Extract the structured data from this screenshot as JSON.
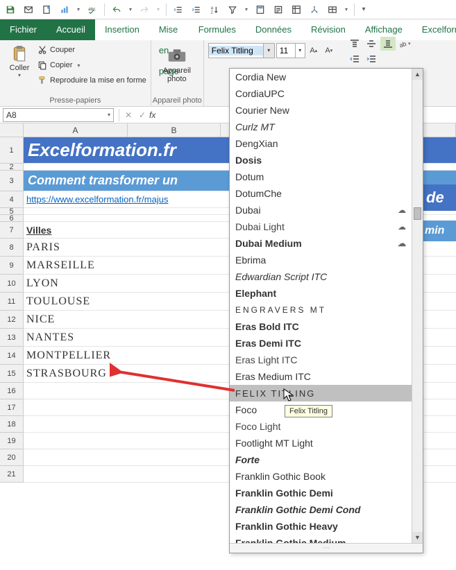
{
  "qat": {
    "icons": [
      "save",
      "mail",
      "newdoc",
      "chart",
      "spell",
      "undo",
      "redo",
      "outdent",
      "indent",
      "sort",
      "filter",
      "calc",
      "form",
      "pivot",
      "tree",
      "table"
    ]
  },
  "tabs": {
    "file": "Fichier",
    "items": [
      "Accueil",
      "Insertion",
      "Mise en page",
      "Formules",
      "Données",
      "Révision",
      "Affichage",
      "Excelform"
    ],
    "active_index": 0
  },
  "ribbon": {
    "paste_label": "Coller",
    "clip": {
      "cut": "Couper",
      "copy": "Copier",
      "repro": "Reproduire la mise en forme",
      "group": "Presse-papiers"
    },
    "camera": {
      "label": "Appareil\nphoto",
      "group": "Appareil photo"
    },
    "font": {
      "name": "Felix Titling",
      "size": "11"
    }
  },
  "formula_bar": {
    "name_box": "A8",
    "value": ""
  },
  "columns": [
    "A",
    "B"
  ],
  "rows": [
    {
      "num": "1",
      "type": "banner1",
      "text": "Excelformation.fr"
    },
    {
      "num": "2",
      "type": "short",
      "text": ""
    },
    {
      "num": "3",
      "type": "banner2",
      "text": "Comment transformer un"
    },
    {
      "num": "4",
      "type": "link",
      "text": "https://www.excelformation.fr/majus"
    },
    {
      "num": "5",
      "type": "short",
      "text": ""
    },
    {
      "num": "6",
      "type": "short",
      "text": ""
    },
    {
      "num": "7",
      "type": "head",
      "text": "Villes"
    },
    {
      "num": "8",
      "type": "city",
      "text": "PARIS"
    },
    {
      "num": "9",
      "type": "city",
      "text": "MARSEILLE"
    },
    {
      "num": "10",
      "type": "city",
      "text": "LYON"
    },
    {
      "num": "11",
      "type": "city",
      "text": "TOULOUSE"
    },
    {
      "num": "12",
      "type": "city",
      "text": "NICE"
    },
    {
      "num": "13",
      "type": "city",
      "text": "NANTES"
    },
    {
      "num": "14",
      "type": "city",
      "text": "MONTPELLIER"
    },
    {
      "num": "15",
      "type": "city",
      "text": "STRASBOURG"
    },
    {
      "num": "16",
      "type": "empty",
      "text": ""
    },
    {
      "num": "17",
      "type": "empty",
      "text": ""
    },
    {
      "num": "18",
      "type": "empty",
      "text": ""
    },
    {
      "num": "19",
      "type": "empty",
      "text": ""
    },
    {
      "num": "20",
      "type": "empty",
      "text": ""
    },
    {
      "num": "21",
      "type": "empty",
      "text": ""
    }
  ],
  "right_bars": {
    "bar1": "de",
    "bar2": "min"
  },
  "font_dropdown": {
    "selected": "FELIX TITLING",
    "tooltip": "Felix Titling",
    "items": [
      {
        "label": "Cordia New",
        "cls": "f-sans"
      },
      {
        "label": "CordiaUPC",
        "cls": "f-sans"
      },
      {
        "label": "Courier New",
        "cls": "f-mono"
      },
      {
        "label": "Curlz MT",
        "cls": "f-script"
      },
      {
        "label": "DengXian",
        "cls": "f-sans"
      },
      {
        "label": "Dosis",
        "cls": "f-sans f-bold"
      },
      {
        "label": "Dotum",
        "cls": "f-sans"
      },
      {
        "label": "DotumChe",
        "cls": "f-sans"
      },
      {
        "label": "Dubai",
        "cls": "f-sans",
        "cloud": true
      },
      {
        "label": "Dubai Light",
        "cls": "f-light",
        "cloud": true
      },
      {
        "label": "Dubai Medium",
        "cls": "f-sans f-bold",
        "cloud": true
      },
      {
        "label": "Ebrima",
        "cls": "f-sans"
      },
      {
        "label": "Edwardian Script ITC",
        "cls": "f-script"
      },
      {
        "label": "Elephant",
        "cls": "f-serif f-bold"
      },
      {
        "label": "ENGRAVERS MT",
        "cls": "f-wide"
      },
      {
        "label": "Eras Bold ITC",
        "cls": "f-sans f-bold"
      },
      {
        "label": "Eras Demi ITC",
        "cls": "f-sans f-bold"
      },
      {
        "label": "Eras Light ITC",
        "cls": "f-light"
      },
      {
        "label": "Eras Medium ITC",
        "cls": "f-sans"
      },
      {
        "label": "FELIX TITLING",
        "cls": "f-sc",
        "selected": true
      },
      {
        "label": "Foco",
        "cls": "f-sans"
      },
      {
        "label": "Foco Light",
        "cls": "f-light"
      },
      {
        "label": "Footlight MT Light",
        "cls": "f-serif"
      },
      {
        "label": "Forte",
        "cls": "f-ital"
      },
      {
        "label": "Franklin Gothic Book",
        "cls": "f-sans"
      },
      {
        "label": "Franklin Gothic Demi",
        "cls": "f-sans f-bold"
      },
      {
        "label": "Franklin Gothic Demi Cond",
        "cls": "f-cond"
      },
      {
        "label": "Franklin Gothic Heavy",
        "cls": "f-sans f-bold"
      },
      {
        "label": "Franklin Gothic Medium",
        "cls": "f-sans f-bold"
      }
    ]
  }
}
